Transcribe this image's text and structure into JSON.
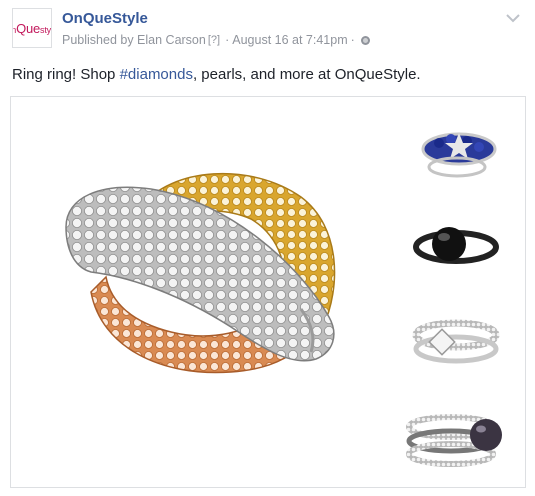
{
  "post": {
    "page_name": "OnQueStyle",
    "avatar": {
      "logo_text_small": "on",
      "logo_text_big": "Que",
      "logo_text_tail": "style"
    },
    "published_by": "Published by Elan Carson",
    "help_marker": "[?]",
    "separator": "·",
    "date": "August 16 at 7:41pm",
    "privacy_icon": "globe-icon",
    "options_icon": "chevron-down-icon",
    "message_prefix": "Ring ring! Shop ",
    "message_hashtag": "#diamonds",
    "message_suffix": ", pearls, and more at OnQueStyle.",
    "colors": {
      "link": "#365899",
      "meta": "#90949c",
      "text": "#1d2129",
      "border": "#dddfe2"
    },
    "photo": {
      "main_image": "gold-silver-rose-diamond-ring",
      "thumbnails": [
        "sapphire-diamond-ring",
        "black-onyx-ring",
        "princess-cut-diamond-ring",
        "black-pearl-ring"
      ]
    }
  }
}
